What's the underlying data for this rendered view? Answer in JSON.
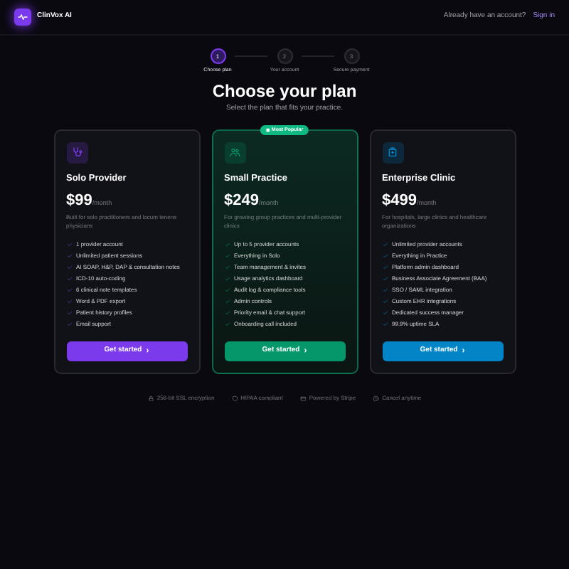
{
  "header": {
    "brand": "ClinVox AI",
    "prompt": "Already have an account?",
    "sign_in": "Sign in"
  },
  "steps": [
    {
      "number": "1",
      "label": "Choose plan",
      "selected": true
    },
    {
      "number": "2",
      "label": "Your account",
      "selected": false
    },
    {
      "number": "3",
      "label": "Secure payment",
      "selected": false
    }
  ],
  "title": "Choose your plan",
  "subtitle": "Select the plan that fits your practice.",
  "plans": [
    {
      "name": "Solo Provider",
      "price": "$99",
      "period": "/month",
      "description": "Built for solo practitioners and locum tenens physicians",
      "color": "#7c3aed",
      "features": [
        "1 provider account",
        "Unlimited patient sessions",
        "AI SOAP, H&P, DAP & consultation notes",
        "ICD-10 auto-coding",
        "6 clinical note templates",
        "Word & PDF export",
        "Patient history profiles",
        "Email support"
      ],
      "button": "Get started",
      "button_icon": "›"
    },
    {
      "name": "Small Practice",
      "price": "$249",
      "period": "/month",
      "description": "For growing group practices and multi-provider clinics",
      "color": "#059669",
      "badge": "Most Popular",
      "features": [
        "Up to 5 provider accounts",
        "Everything in Solo",
        "Team management & invites",
        "Usage analytics dashboard",
        "Audit log & compliance tools",
        "Admin controls",
        "Priority email & chat support",
        "Onboarding call included"
      ],
      "button": "Get started",
      "button_icon": "›"
    },
    {
      "name": "Enterprise Clinic",
      "price": "$499",
      "period": "/month",
      "description": "For hospitals, large clinics and healthcare organizations",
      "color": "#0284c7",
      "features": [
        "Unlimited provider accounts",
        "Everything in Practice",
        "Platform admin dashboard",
        "Business Associate Agreement (BAA)",
        "SSO / SAML integration",
        "Custom EHR integrations",
        "Dedicated success manager",
        "99.9% uptime SLA"
      ],
      "button": "Get started",
      "button_icon": "›"
    }
  ],
  "trust": [
    "256-bit SSL encryption",
    "HIPAA compliant",
    "Powered by Stripe",
    "Cancel anytime"
  ]
}
